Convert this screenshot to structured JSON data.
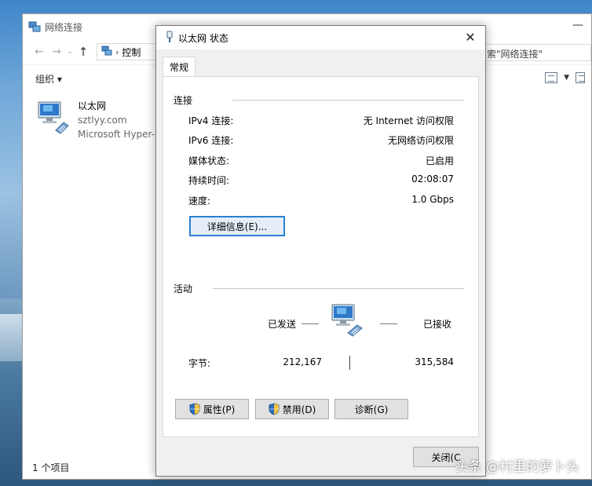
{
  "explorer": {
    "title": "网络连接",
    "address_crumb": "控制",
    "search_text": "索\"网络连接\"",
    "organize_label": "组织 ▾",
    "adapter": {
      "name": "以太网",
      "network": "sztlyy.com",
      "device": "Microsoft Hyper-"
    },
    "status_text": "1 个项目"
  },
  "dialog": {
    "title": "以太网 状态",
    "tab_general": "常规",
    "connection_group": "连接",
    "rows": [
      {
        "label": "IPv4 连接:",
        "value": "无 Internet 访问权限"
      },
      {
        "label": "IPv6 连接:",
        "value": "无网络访问权限"
      },
      {
        "label": "媒体状态:",
        "value": "已启用"
      },
      {
        "label": "持续时间:",
        "value": "02:08:07"
      },
      {
        "label": "速度:",
        "value": "1.0 Gbps"
      }
    ],
    "details_button": "详细信息(E)...",
    "activity_group": "活动",
    "sent_label": "已发送",
    "received_label": "已接收",
    "bytes_label": "字节:",
    "bytes_sent": "212,167",
    "bytes_received": "315,584",
    "properties_button": "属性(P)",
    "disable_button": "禁用(D)",
    "diagnose_button": "诊断(G)",
    "close_button": "关闭(C"
  },
  "watermark": "头条 @村里的萝卜头",
  "colors": {
    "focus_border": "#2a7fd4",
    "button_face": "#e1e1e1",
    "dialog_face": "#f0f0f0"
  },
  "icons": [
    "network-connections-icon",
    "ethernet-adapter-icon",
    "network-activity-icon",
    "uac-shield-icon",
    "close-icon",
    "back-arrow-icon",
    "forward-arrow-icon",
    "up-arrow-icon"
  ]
}
